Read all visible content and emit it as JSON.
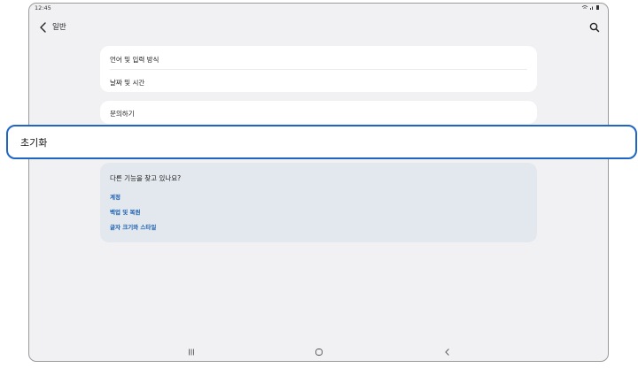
{
  "status": {
    "time": "12:45",
    "icons": "≋⋅▐▊"
  },
  "appbar": {
    "title": "일반",
    "back_icon": "chevron-left-icon",
    "search_icon": "search-icon"
  },
  "settings": {
    "group1": [
      {
        "label": "언어 및 입력 방식"
      },
      {
        "label": "날짜 및 시간"
      }
    ],
    "group2": [
      {
        "label": "문의하기"
      }
    ],
    "reset": {
      "label": "초기화"
    }
  },
  "suggestions": {
    "title": "다른 기능을 찾고 있나요?",
    "links": [
      "계정",
      "백업 및 복원",
      "글자 크기와 스타일"
    ],
    "link_color": "#1a5fb0"
  },
  "navbar": {
    "recent_icon": "recent-apps-icon",
    "home_icon": "home-icon",
    "back_icon": "back-icon"
  },
  "colors": {
    "highlight_border": "#1f66c4",
    "background": "#f1f1f3",
    "card": "#ffffff",
    "suggestion_card": "#e3e8ee"
  }
}
